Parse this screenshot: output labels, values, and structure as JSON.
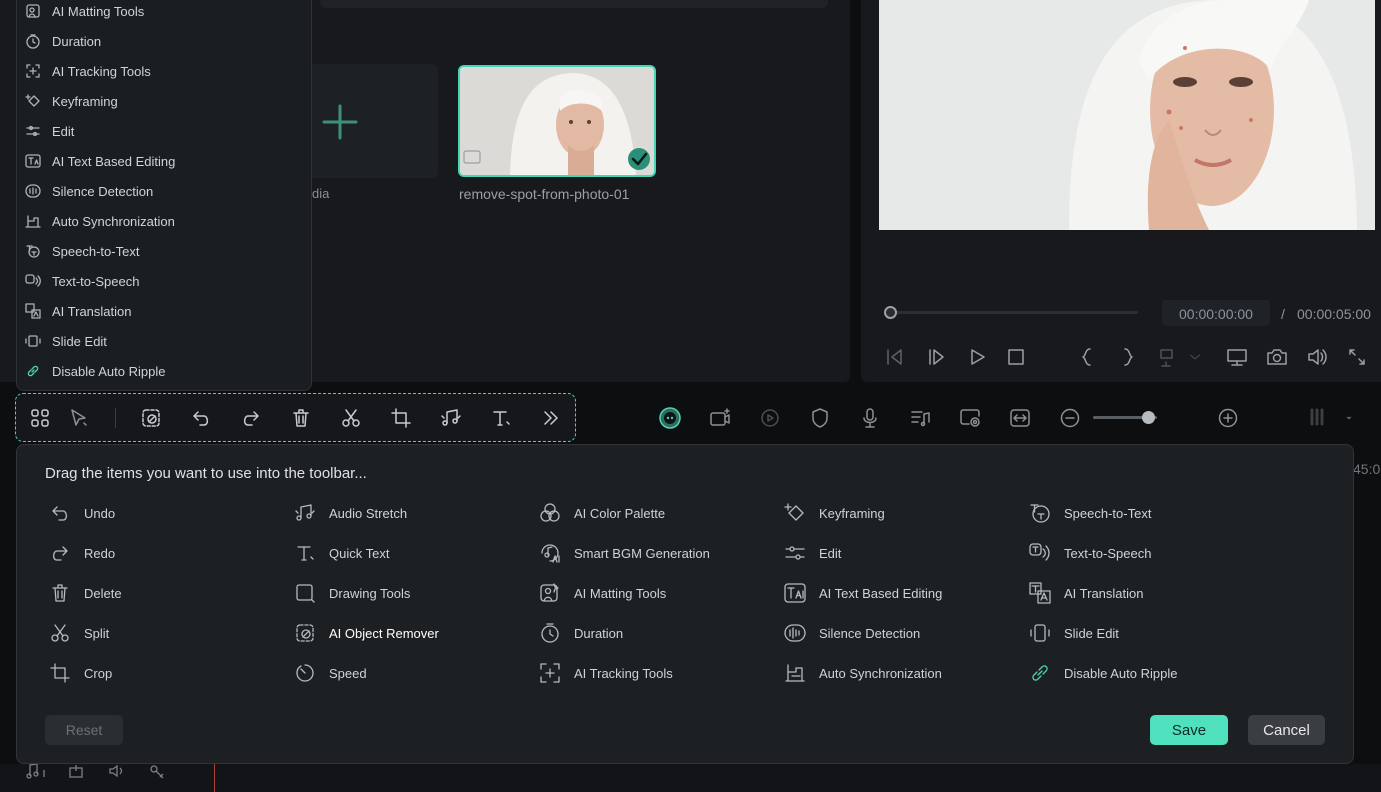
{
  "media": {
    "import_label": "dia",
    "clip_name": "remove-spot-from-photo-01"
  },
  "preview": {
    "time_current": "00:00:00:00",
    "time_separator": "/",
    "time_total": "00:00:05:00",
    "ruler_fragment": "45:0"
  },
  "left_menu": {
    "items": [
      {
        "label": "AI Matting Tools",
        "icon": "matting-icon"
      },
      {
        "label": "Duration",
        "icon": "clock-icon"
      },
      {
        "label": "AI Tracking Tools",
        "icon": "tracking-icon"
      },
      {
        "label": "Keyframing",
        "icon": "keyframe-icon"
      },
      {
        "label": "Edit",
        "icon": "sliders-icon"
      },
      {
        "label": "AI Text Based Editing",
        "icon": "text-ai-icon"
      },
      {
        "label": "Silence Detection",
        "icon": "waveform-icon"
      },
      {
        "label": "Auto Synchronization",
        "icon": "sync-icon"
      },
      {
        "label": "Speech-to-Text",
        "icon": "speech-text-icon"
      },
      {
        "label": "Text-to-Speech",
        "icon": "text-speech-icon"
      },
      {
        "label": "AI Translation",
        "icon": "translate-icon"
      },
      {
        "label": "Slide Edit",
        "icon": "slide-edit-icon"
      },
      {
        "label": "Disable Auto Ripple",
        "icon": "link-icon"
      }
    ]
  },
  "dialog": {
    "title": "Drag the items you want to use into the toolbar...",
    "columns": [
      [
        {
          "label": "Undo",
          "icon": "undo-icon"
        },
        {
          "label": "Redo",
          "icon": "redo-icon"
        },
        {
          "label": "Delete",
          "icon": "trash-icon"
        },
        {
          "label": "Split",
          "icon": "scissors-icon"
        },
        {
          "label": "Crop",
          "icon": "crop-icon"
        }
      ],
      [
        {
          "label": "Audio Stretch",
          "icon": "audio-stretch-icon"
        },
        {
          "label": "Quick Text",
          "icon": "text-icon"
        },
        {
          "label": "Drawing Tools",
          "icon": "square-icon"
        },
        {
          "label": "AI Object Remover",
          "icon": "object-remover-icon"
        },
        {
          "label": "Speed",
          "icon": "speed-icon"
        }
      ],
      [
        {
          "label": "AI Color Palette",
          "icon": "palette-icon"
        },
        {
          "label": "Smart BGM Generation",
          "icon": "bgm-icon"
        },
        {
          "label": "AI Matting Tools",
          "icon": "matting-icon"
        },
        {
          "label": "Duration",
          "icon": "clock-icon"
        },
        {
          "label": "AI Tracking Tools",
          "icon": "tracking-icon"
        }
      ],
      [
        {
          "label": "Keyframing",
          "icon": "keyframe-icon"
        },
        {
          "label": "Edit",
          "icon": "sliders-icon"
        },
        {
          "label": "AI Text Based Editing",
          "icon": "text-ai-icon"
        },
        {
          "label": "Silence Detection",
          "icon": "waveform-icon"
        },
        {
          "label": "Auto Synchronization",
          "icon": "sync-icon"
        }
      ],
      [
        {
          "label": "Speech-to-Text",
          "icon": "speech-text-icon"
        },
        {
          "label": "Text-to-Speech",
          "icon": "text-speech-icon"
        },
        {
          "label": "AI Translation",
          "icon": "translate-icon"
        },
        {
          "label": "Slide Edit",
          "icon": "slide-edit-icon"
        },
        {
          "label": "Disable Auto Ripple",
          "icon": "link-icon"
        }
      ]
    ],
    "reset_label": "Reset",
    "save_label": "Save",
    "cancel_label": "Cancel"
  },
  "colors": {
    "accent": "#4fe0bd",
    "panel": "#1d2023",
    "background": "#0d0e10"
  }
}
